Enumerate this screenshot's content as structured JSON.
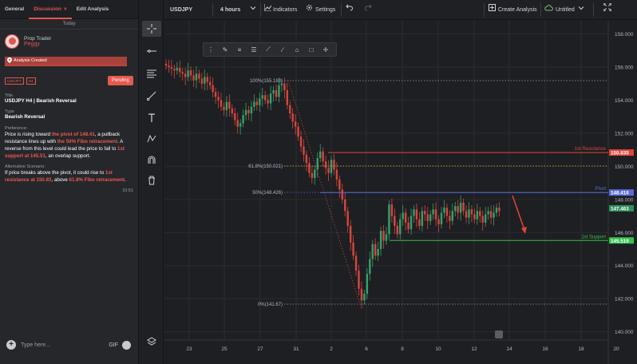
{
  "tabs": [
    {
      "label": "General"
    },
    {
      "label": "Discussion",
      "close": "×"
    },
    {
      "label": "Edit Analysis"
    }
  ],
  "day_separator": "Today",
  "post": {
    "role": "Prop Trader",
    "name": "Peggy",
    "created_label": "Analysis Created",
    "badges": [
      "USDJPY",
      "H4"
    ],
    "status": "Pending",
    "title_label": "Title",
    "title": "USDJPY H4 | Bearish Reversal",
    "type_label": "Type",
    "type": "Bearish Reversal",
    "preference_label": "Preference:",
    "preference_parts": [
      "Price is rising toward ",
      "the pivot of 148.41",
      ", a pullback resistance lines up with ",
      "the 50% Fibo retracement",
      ". A reverse from this level could lead the price to fall to ",
      "1st support at 145.51",
      ", an overlap support."
    ],
    "alt_label": "Alternative Scenario:",
    "alt_parts": [
      "If price breaks above the pivot, it could rise to ",
      "1st resistance at 150.83",
      ", above ",
      "61.8% Fibo retracement",
      "."
    ],
    "time": "10:51"
  },
  "composer": {
    "placeholder": "Type here...",
    "gif": "GIF"
  },
  "topbar": {
    "symbol": "USDJPY",
    "interval": "4 hours",
    "indicators": "Indicators",
    "settings": "Settings",
    "create_analysis": "Create Analysis",
    "layout_name": "Untitled"
  },
  "colors": {
    "accent": "#e8594f",
    "resistance": "#e0453d",
    "pivot": "#5b6bd9",
    "support": "#33c24d",
    "fib": "#9a9da6",
    "bull": "#33a36b",
    "bear": "#d9453d"
  },
  "chart_data": {
    "type": "candlestick",
    "symbol": "USDJPY",
    "interval": "4 hours",
    "ylim": [
      139.5,
      158.8
    ],
    "y_ticks": [
      "158.000",
      "156.000",
      "154.000",
      "152.000",
      "150.000",
      "148.000",
      "146.000",
      "144.000",
      "142.000",
      "140.000"
    ],
    "x_ticks": [
      "23",
      "25",
      "27",
      "31",
      "2",
      "6",
      "8",
      "10",
      "12",
      "14",
      "16",
      "18",
      "20"
    ],
    "levels": [
      {
        "name": "1st Resistance",
        "value": "150.835",
        "price": 150.835
      },
      {
        "name": "Pivot",
        "value": "148.416",
        "price": 148.416
      },
      {
        "name": "",
        "value": "147.463",
        "price": 147.463
      },
      {
        "name": "1st Support",
        "value": "145.519",
        "price": 145.519
      }
    ],
    "fib_levels": [
      {
        "label": "100%(155.183)",
        "price": 155.183
      },
      {
        "label": "61.8%(150.021)",
        "price": 150.021
      },
      {
        "label": "50%(148.426)",
        "price": 148.426
      },
      {
        "label": "0%(141.67)",
        "price": 141.67
      }
    ],
    "closes": [
      156.1,
      156.0,
      155.9,
      155.8,
      155.95,
      155.7,
      155.6,
      155.4,
      155.8,
      155.5,
      155.2,
      155.6,
      155.3,
      155.0,
      155.4,
      155.1,
      154.9,
      154.5,
      154.2,
      154.0,
      153.6,
      153.4,
      153.9,
      153.5,
      153.2,
      152.8,
      152.4,
      152.6,
      153.1,
      153.4,
      153.2,
      153.6,
      153.9,
      153.7,
      154.1,
      154.3,
      154.0,
      153.8,
      154.4,
      154.6,
      154.2,
      154.9,
      155.0,
      154.6,
      153.7,
      153.2,
      152.7,
      152.4,
      151.8,
      151.2,
      150.7,
      150.2,
      149.6,
      149.3,
      149.8,
      150.5,
      150.9,
      150.3,
      149.9,
      149.6,
      150.4,
      149.8,
      149.2,
      148.6,
      148.0,
      147.3,
      146.4,
      145.4,
      144.6,
      143.7,
      142.6,
      141.9,
      142.3,
      143.5,
      144.4,
      145.3,
      144.6,
      145.0,
      146.1,
      145.5,
      145.9,
      147.7,
      147.0,
      146.4,
      145.9,
      146.8,
      147.2,
      146.6,
      146.2,
      147.0,
      147.4,
      146.8,
      146.4,
      147.3,
      147.1,
      146.7,
      147.1,
      147.4,
      146.8,
      146.5,
      147.2,
      147.5,
      147.0,
      146.7,
      147.3,
      147.6,
      147.2,
      147.8,
      147.3,
      146.9,
      147.4,
      147.1,
      146.8,
      147.3,
      147.0,
      146.6,
      147.1,
      147.3,
      146.9,
      147.2,
      147.5,
      147.3
    ]
  }
}
